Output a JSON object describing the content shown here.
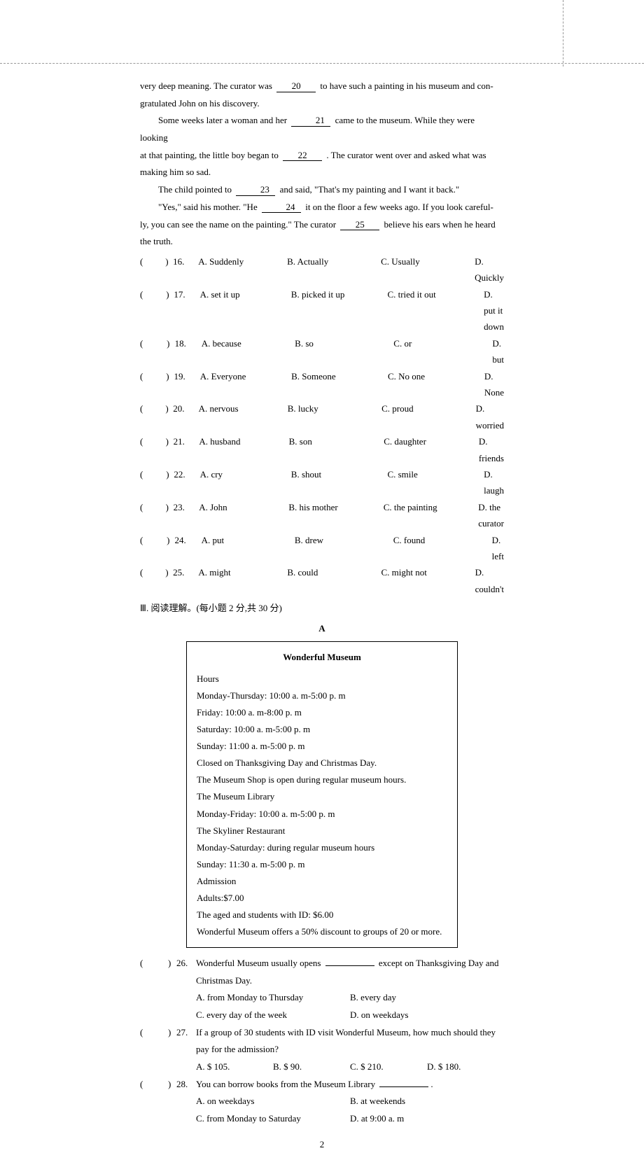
{
  "passage": {
    "p1a": "very deep meaning. The curator was ",
    "b20": "20",
    "p1b": " to have such a painting in his museum and con-",
    "p1c": "gratulated John on his discovery.",
    "p2a": "Some weeks later a woman and her ",
    "b21": "21",
    "p2b": " came to the museum. While they were looking",
    "p2c": "at that painting, the little boy began to ",
    "b22": "22",
    "p2d": ". The curator went over and asked what was",
    "p2e": "making him so sad.",
    "p3a": "The child pointed to ",
    "b23": "23",
    "p3b": " and said, \"That's my painting and I want it back.\"",
    "p4a": "\"Yes,\" said his mother. \"He ",
    "b24": "24",
    "p4b": " it on the floor a few weeks ago. If you look careful-",
    "p4c": "ly, you can see the name on the painting.\" The curator ",
    "b25": "25",
    "p4d": " believe his ears when he heard",
    "p4e": "the truth."
  },
  "cloze": [
    {
      "num": "16.",
      "a": "A. Suddenly",
      "b": "B. Actually",
      "c": "C. Usually",
      "d": "D. Quickly"
    },
    {
      "num": "17.",
      "a": "A. set it up",
      "b": "B. picked it up",
      "c": "C. tried it out",
      "d": "D. put it down"
    },
    {
      "num": "18.",
      "a": "A. because",
      "b": "B. so",
      "c": "C. or",
      "d": "D. but"
    },
    {
      "num": "19.",
      "a": "A. Everyone",
      "b": "B. Someone",
      "c": "C. No one",
      "d": "D. None"
    },
    {
      "num": "20.",
      "a": "A. nervous",
      "b": "B. lucky",
      "c": "C. proud",
      "d": "D. worried"
    },
    {
      "num": "21.",
      "a": "A. husband",
      "b": "B. son",
      "c": "C. daughter",
      "d": "D. friends"
    },
    {
      "num": "22.",
      "a": "A. cry",
      "b": "B. shout",
      "c": "C. smile",
      "d": "D. laugh"
    },
    {
      "num": "23.",
      "a": "A. John",
      "b": "B. his mother",
      "c": "C. the painting",
      "d": "D. the curator"
    },
    {
      "num": "24.",
      "a": "A. put",
      "b": "B. drew",
      "c": "C. found",
      "d": "D. left"
    },
    {
      "num": "25.",
      "a": "A. might",
      "b": "B. could",
      "c": "C. might not",
      "d": "D. couldn't"
    }
  ],
  "section3": "Ⅲ. 阅读理解。(每小题 2 分,共 30 分)",
  "labelA": "A",
  "museum": {
    "title": "Wonderful Museum",
    "lines": [
      "Hours",
      "Monday-Thursday: 10:00 a. m-5:00 p. m",
      "Friday: 10:00 a. m-8:00 p. m",
      "Saturday: 10:00 a. m-5:00 p. m",
      "Sunday: 11:00 a. m-5:00 p. m",
      "Closed on Thanksgiving Day and Christmas Day.",
      "The Museum Shop is open during regular museum hours.",
      "The Museum Library",
      "Monday-Friday: 10:00 a. m-5:00 p. m",
      "The Skyliner Restaurant",
      "Monday-Saturday: during regular museum hours",
      "Sunday: 11:30 a. m-5:00 p. m",
      "Admission",
      "Adults:$7.00",
      "The aged and students with ID: $6.00",
      "Wonderful Museum offers a 50% discount to groups of 20 or more."
    ]
  },
  "q26": {
    "num": "26.",
    "text1": "Wonderful Museum usually opens ",
    "text2": " except on Thanksgiving Day and",
    "text3": "Christmas Day.",
    "a": "A. from Monday to Thursday",
    "b": "B. every day",
    "c": "C. every day of the week",
    "d": "D. on weekdays"
  },
  "q27": {
    "num": "27.",
    "text1": "If a group of 30 students with ID visit Wonderful Museum, how much should they",
    "text2": "pay for the admission?",
    "a": "A. $ 105.",
    "b": "B. $ 90.",
    "c": "C. $ 210.",
    "d": "D. $ 180."
  },
  "q28": {
    "num": "28.",
    "text1": "You can borrow books from the Museum Library ",
    "a": "A. on weekdays",
    "b": "B. at weekends",
    "c": "C. from Monday to Saturday",
    "d": "D. at 9:00 a. m"
  },
  "pagenum": "2",
  "paren_l": "(",
  "paren_r": ")"
}
